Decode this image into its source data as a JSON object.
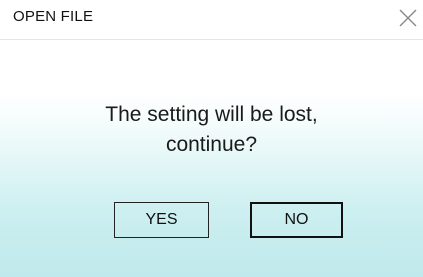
{
  "dialog": {
    "title": "OPEN FILE",
    "close_icon": "close-x-icon",
    "message_line1": "The setting will be lost,",
    "message_line2": "continue?",
    "yes_label": "YES",
    "no_label": "NO"
  },
  "colors": {
    "title_text": "#111111",
    "body_gradient_top": "#ffffff",
    "body_gradient_bottom": "#bfe9ec",
    "button_border": "#111111"
  }
}
